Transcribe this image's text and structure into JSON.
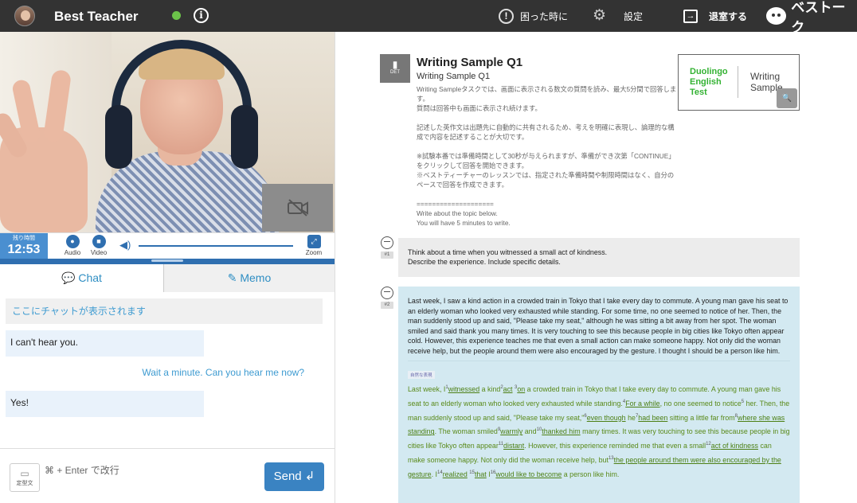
{
  "topbar": {
    "teacher_name": "Best Teacher",
    "status_color": "#6cc24a",
    "info_glyph": "i",
    "help_label": "困った時に",
    "settings_label": "設定",
    "exit_label": "退室する",
    "logo_text": "ベストーク"
  },
  "timer": {
    "label": "残り時間",
    "value": "12:53"
  },
  "media_controls": {
    "audio_label": "Audio",
    "video_label": "Video",
    "zoom_label": "Zoom"
  },
  "tabs": [
    {
      "label": "Chat"
    },
    {
      "label": "Memo"
    }
  ],
  "chat": {
    "placeholder_notice": "ここにチャットが表示されます",
    "messages": [
      {
        "text": "I can't hear you.",
        "side": "left"
      },
      {
        "text": "Wait a minute. Can you hear me now?",
        "side": "right"
      },
      {
        "text": "Yes!",
        "side": "left"
      }
    ]
  },
  "composer": {
    "template_label": "定型文",
    "hint": "⌘ + Enter で改行",
    "send_label": "Send ↲"
  },
  "question": {
    "badge": "DET",
    "title": "Writing Sample Q1",
    "subtitle": "Writing Sample Q1",
    "description": "Writing Sampleタスクでは、画面に表示される数文の質問を読み、最大5分間で回答します。\n質問は回答中も画面に表示され続けます。\n\n記述した英作文は出題先に自動的に共有されるため、考えを明確に表現し、論理的な構成で内容を記述することが大切です。\n\n※試験本番では準備時間として30秒が与えられますが、準備ができ次第「CONTINUE」をクリックして回答を開始できます。\n※ベストティーチャーのレッスンでは、指定された準備時間や制限時間はなく、自分のペースで回答を作成できます。\n\n====================\nWrite about the topic below.\nYou will have 5 minutes to write."
  },
  "det_card": {
    "brand": "Duolingo\nEnglish\nTest",
    "label": "Writing\nSample"
  },
  "posts": [
    {
      "number": "#1",
      "text": "Think about a time when you witnessed a small act of kindness.\nDescribe the experience. Include specific details."
    },
    {
      "number": "#2",
      "text": "Last week, I saw a kind action in a crowded train in Tokyo that I take every day to commute. A young man gave his seat to an elderly woman who looked very exhausted while standing. For some time, no one seemed to notice of her. Then, the man suddenly stood up and said, \"Please take my seat,\" although he was sitting a bit away from her spot. The woman smiled and said thank you many times. It is very touching to see this because people in big cities like Tokyo often appear cold. However, this experience teaches me that even a small action can make someone happy. Not only did the woman receive help, but the people around them were also encouraged by the gesture. I thought I should be a person like him.",
      "correction_tag": "自然な表現",
      "correction": [
        {
          "t": "Last week, I"
        },
        {
          "n": "1"
        },
        {
          "u": "witnessed"
        },
        {
          "t": " a kind"
        },
        {
          "n": "2"
        },
        {
          "u": "act"
        },
        {
          "t": " "
        },
        {
          "n": "3"
        },
        {
          "u": "on"
        },
        {
          "t": " a crowded train in Tokyo that I take every day to commute. A young man gave his seat to an elderly woman who looked very exhausted while standing."
        },
        {
          "n": "4"
        },
        {
          "u": "For a while"
        },
        {
          "t": ", no one seemed to notice"
        },
        {
          "n": "5"
        },
        {
          "t": " her. Then, the man suddenly stood up and said, \"Please take my seat,\""
        },
        {
          "n": "6"
        },
        {
          "u": "even though"
        },
        {
          "t": " he"
        },
        {
          "n": "7"
        },
        {
          "u": "had been"
        },
        {
          "t": " sitting a little far from"
        },
        {
          "n": "8"
        },
        {
          "u": "where she was standing"
        },
        {
          "t": ". The woman smiled"
        },
        {
          "n": "9"
        },
        {
          "u": "warmly"
        },
        {
          "t": " and"
        },
        {
          "n": "10"
        },
        {
          "u": "thanked him"
        },
        {
          "t": " many times. It was very touching to see this because people in big cities like Tokyo often appear"
        },
        {
          "n": "11"
        },
        {
          "u": "distant"
        },
        {
          "t": ". However, this experience reminded me that even a small"
        },
        {
          "n": "12"
        },
        {
          "u": "act of kindness"
        },
        {
          "t": " can make someone happy. Not only did the woman receive help, but"
        },
        {
          "n": "13"
        },
        {
          "u": "the people around them were also encouraged by the gesture"
        },
        {
          "t": ". I"
        },
        {
          "n": "14"
        },
        {
          "u": "realized"
        },
        {
          "t": " "
        },
        {
          "n": "15"
        },
        {
          "u": "that"
        },
        {
          "t": " I"
        },
        {
          "n": "16"
        },
        {
          "u": "would like to become"
        },
        {
          "t": " a person like him."
        }
      ]
    }
  ],
  "icons": {
    "camera_off": "camera-off-icon",
    "chat": "chat-bubble-icon",
    "memo": "pencil-square-icon"
  }
}
